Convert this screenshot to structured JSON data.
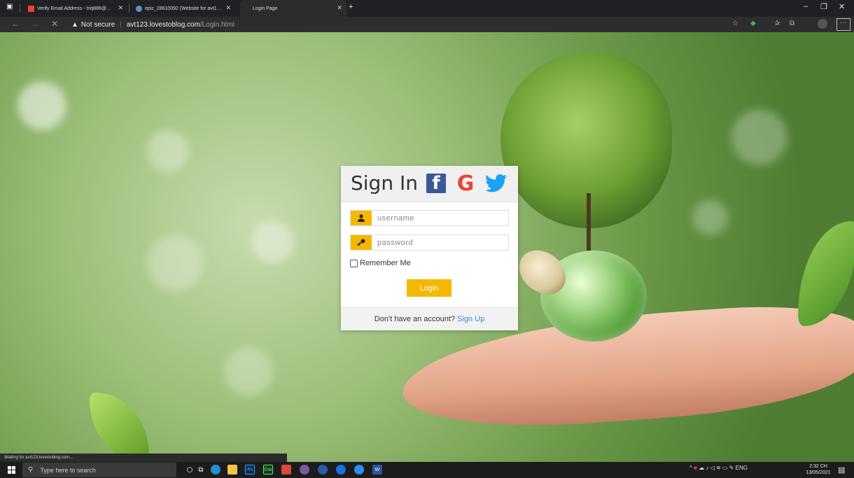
{
  "browser": {
    "tabs": [
      {
        "label": "Verify Email Address - triq886@…"
      },
      {
        "label": "epiz_28610092 (Website for avt1…"
      },
      {
        "label": "Login Page"
      }
    ],
    "address": {
      "security": "Not secure",
      "domain": "avt123.lovestoblog.com",
      "path": "/Login.html"
    },
    "status": "Waiting for avt123.lovestoblog.com..."
  },
  "login": {
    "title": "Sign In",
    "social": {
      "facebook": "f",
      "google": "G"
    },
    "username_placeholder": "username",
    "password_placeholder": "password",
    "remember_label": "Remember Me",
    "login_label": "Login",
    "footer_text": "Don't have an account?",
    "signup_label": "Sign Up"
  },
  "colors": {
    "accent": "#f5b800",
    "facebook": "#3b5998",
    "google": "#ea4335",
    "twitter": "#1da1f2",
    "link": "#3b8bd0"
  },
  "taskbar": {
    "search_placeholder": "Type here to search",
    "apps": [
      "Ps",
      "Dw",
      "W"
    ],
    "language": "ENG",
    "time": "2:32 CH",
    "date": "13/05/2021"
  }
}
